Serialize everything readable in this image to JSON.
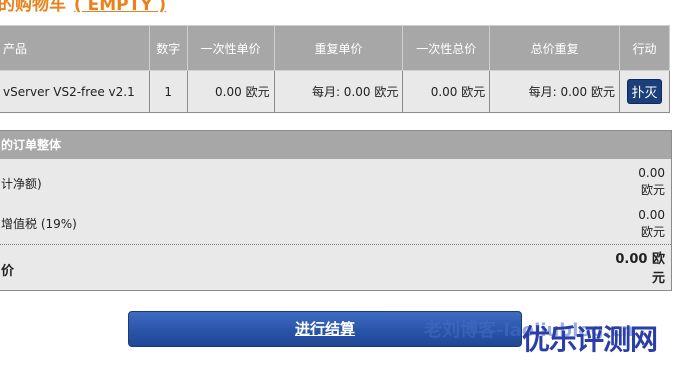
{
  "cart": {
    "title": "的购物车",
    "status": "( EMPTY )"
  },
  "table": {
    "headers": [
      "产品",
      "数字",
      "一次性单价",
      "重复单价",
      "一次性总价",
      "总价重复",
      "行动"
    ],
    "row": {
      "product": "vServer VS2-free v2.1",
      "qty": "1",
      "onetime_unit": "0.00 欧元",
      "recurring_unit": "每月: 0.00 欧元",
      "onetime_total": "0.00 欧元",
      "recurring_total": "每月: 0.00 欧元",
      "action": "扑灭"
    }
  },
  "summary": {
    "title": "的订单整体",
    "net_label": "计净额)",
    "net_value": "0.00 欧元",
    "vat_label": "增值税 (19%)",
    "vat_value": "0.00 欧元",
    "total_label": "价",
    "total_value": "0.00 欧元"
  },
  "checkout": {
    "label": "进行结算"
  },
  "watermark": {
    "text1": "老刘博客-laoliublog.cn",
    "text2": "优乐评测网"
  },
  "colors": {
    "accent": "#e8821e",
    "header_bg": "#a7a7a7",
    "button": "#2a54a8"
  }
}
